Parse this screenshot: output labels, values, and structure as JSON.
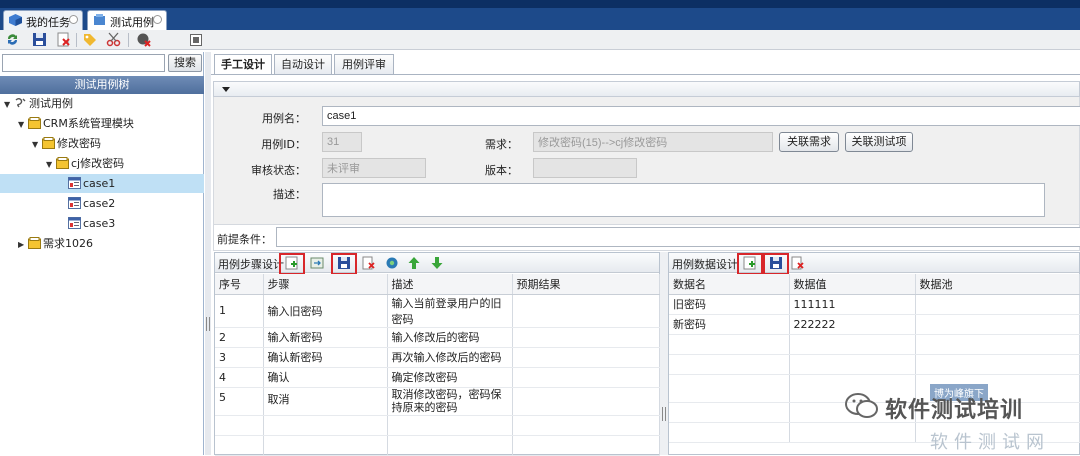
{
  "window_tabs": [
    {
      "label": "我的任务",
      "icon": "cube-icon"
    },
    {
      "label": "测试用例",
      "icon": "box-icon"
    }
  ],
  "left_panel": {
    "search_button": "搜索",
    "search_value": "",
    "tree_title": "测试用例树",
    "tree": [
      {
        "label": "测试用例",
        "level": 0
      },
      {
        "label": "CRM系统管理模块",
        "level": 1
      },
      {
        "label": "修改密码",
        "level": 2
      },
      {
        "label": "cj修改密码",
        "level": 3
      },
      {
        "label": "case1",
        "level": 4,
        "selected": true
      },
      {
        "label": "case2",
        "level": 4
      },
      {
        "label": "case3",
        "level": 4
      },
      {
        "label": "需求1026",
        "level": 1
      }
    ]
  },
  "main_tabs": [
    "手工设计",
    "自动设计",
    "用例评审"
  ],
  "form": {
    "case_name_label": "用例名：",
    "case_name_value": "case1",
    "case_id_label": "用例ID：",
    "case_id_value": "31",
    "requirement_label": "需求：",
    "requirement_value": "修改密码(15)-->cj修改密码",
    "link_requirement_button": "关联需求",
    "link_testcase_button": "关联测试项",
    "review_status_label": "审核状态：",
    "review_status_value": "未评审",
    "version_label": "版本：",
    "version_value": "",
    "description_label": "描述：",
    "description_value": "",
    "precondition_label": "前提条件：",
    "precondition_value": ""
  },
  "steps_grid": {
    "title": "用例步骤设计",
    "columns": [
      "序号",
      "步骤",
      "描述",
      "预期结果"
    ],
    "rows": [
      {
        "no": "1",
        "step": "输入旧密码",
        "desc": "输入当前登录用户的旧密码",
        "expected": ""
      },
      {
        "no": "2",
        "step": "输入新密码",
        "desc": "输入修改后的密码",
        "expected": ""
      },
      {
        "no": "3",
        "step": "确认新密码",
        "desc": "再次输入修改后的密码",
        "expected": ""
      },
      {
        "no": "4",
        "step": "确认",
        "desc": "确定修改密码",
        "expected": ""
      },
      {
        "no": "5",
        "step": "取消",
        "desc": "取消修改密码，密码保持原来的密码",
        "expected": ""
      }
    ]
  },
  "data_grid": {
    "title": "用例数据设计",
    "columns": [
      "数据名",
      "数据值",
      "数据池"
    ],
    "rows": [
      {
        "name": "旧密码",
        "value": "111111",
        "pool": ""
      },
      {
        "name": "新密码",
        "value": "222222",
        "pool": ""
      }
    ]
  },
  "watermark": {
    "line1": "软件测试培训",
    "line2": "软件测试网",
    "badge": "博为峰旗下"
  },
  "colors": {
    "title_bar": "#0c2f63",
    "selected_row": "#bfe0f5",
    "highlight_box": "#d8262a"
  }
}
